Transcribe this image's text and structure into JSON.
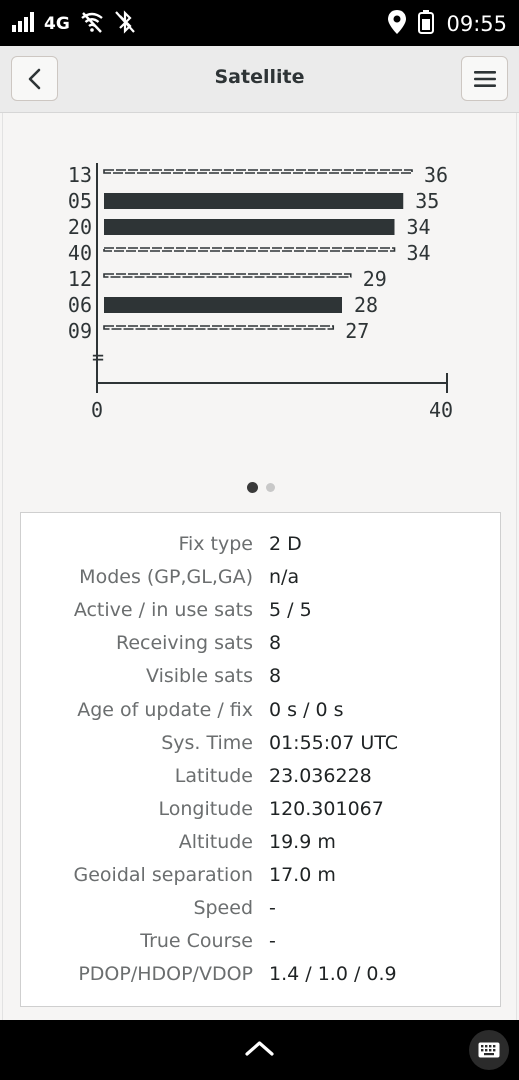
{
  "status": {
    "network": "4G",
    "time": "09:55"
  },
  "header": {
    "title": "Satellite"
  },
  "chart_data": {
    "type": "bar",
    "orientation": "horizontal",
    "categories": [
      "13",
      "05",
      "20",
      "40",
      "12",
      "06",
      "09"
    ],
    "values": [
      36,
      35,
      34,
      34,
      29,
      28,
      27
    ],
    "in_use": [
      false,
      true,
      true,
      false,
      false,
      true,
      false
    ],
    "in_use_color": "#2e3436",
    "not_in_use_style": "dashed-equals",
    "xlim": [
      0,
      40
    ],
    "xticks": [
      "0",
      "40"
    ],
    "extra_row_marker": "=",
    "pages": 2,
    "active_page": 1
  },
  "info": [
    {
      "label": "Fix type",
      "value": "2 D"
    },
    {
      "label": "Modes (GP,GL,GA)",
      "value": "n/a"
    },
    {
      "label": "Active / in use sats",
      "value": "5 / 5"
    },
    {
      "label": "Receiving sats",
      "value": "8"
    },
    {
      "label": "Visible sats",
      "value": "8"
    },
    {
      "label": "Age of update / fix",
      "value": "0 s / 0 s"
    },
    {
      "label": "Sys. Time",
      "value": "01:55:07 UTC"
    },
    {
      "label": "Latitude",
      "value": "23.036228"
    },
    {
      "label": "Longitude",
      "value": "120.301067"
    },
    {
      "label": "Altitude",
      "value": "19.9 m"
    },
    {
      "label": "Geoidal separation",
      "value": "17.0 m"
    },
    {
      "label": "Speed",
      "value": "-"
    },
    {
      "label": "True Course",
      "value": "-"
    },
    {
      "label": "PDOP/HDOP/VDOP",
      "value": "1.4 / 1.0 / 0.9"
    }
  ]
}
